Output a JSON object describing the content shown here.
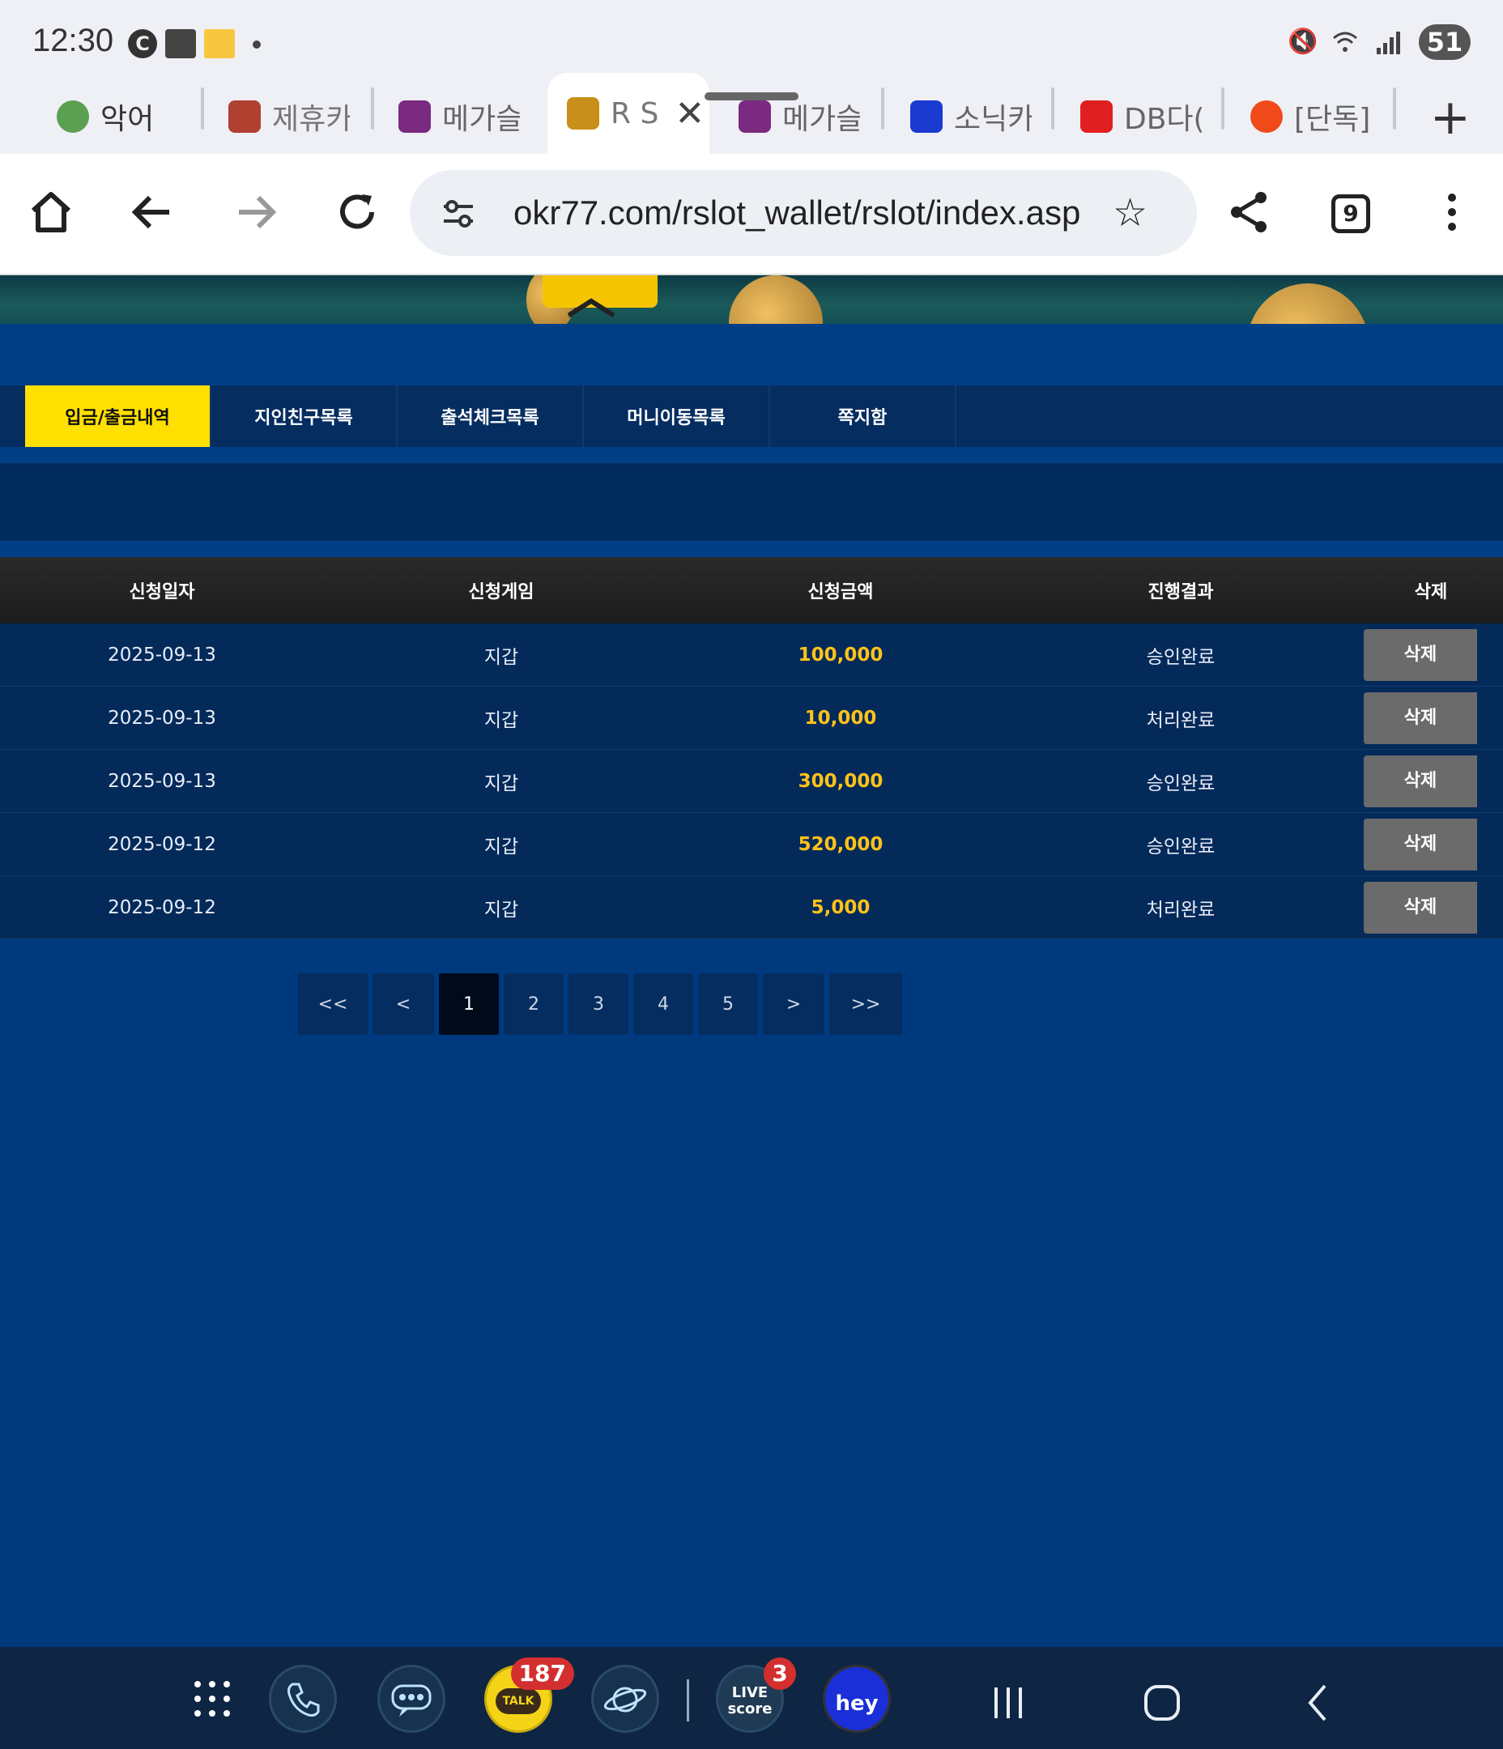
{
  "status_bar": {
    "time": "12:30",
    "left_icons": [
      "c-icon",
      "briefcase-icon",
      "kyochon-icon",
      "dot-icon"
    ],
    "right_icons": [
      "mute-icon",
      "wifi-icon",
      "signal-icon"
    ],
    "battery": "51"
  },
  "browser_tabs": [
    {
      "title": "악어",
      "icon": "crocodile-icon",
      "color": "#5aa050"
    },
    {
      "title": "제휴카",
      "icon": "slot-machine-icon",
      "color": "#b04030"
    },
    {
      "title": "메가슬",
      "icon": "m-logo-icon",
      "color": "#7a2a80"
    },
    {
      "title": "R S",
      "icon": "r-logo-icon",
      "color": "#c8901a",
      "active": true
    },
    {
      "title": "메가슬",
      "icon": "m-logo-icon",
      "color": "#7a2a80"
    },
    {
      "title": "소닉카",
      "icon": "s-logo-icon",
      "color": "#1a3ad0"
    },
    {
      "title": "DB다(",
      "icon": "n-logo-icon",
      "color": "#e02020"
    },
    {
      "title": "[단독]",
      "icon": "i-logo-icon",
      "color": "#f04a1a"
    }
  ],
  "url_bar": {
    "url": "okr77.com/rslot_wallet/rslot/index.asp",
    "tab_count": "9"
  },
  "menu_tabs": [
    {
      "label": "입금/출금내역",
      "active": true
    },
    {
      "label": "지인친구목록"
    },
    {
      "label": "출석체크목록"
    },
    {
      "label": "머니이동목록"
    },
    {
      "label": "쪽지함"
    }
  ],
  "table": {
    "headers": [
      "신청일자",
      "신청게임",
      "신청금액",
      "진행결과",
      "삭제"
    ],
    "rows": [
      {
        "date": "2025-09-13",
        "game": "지갑",
        "amount": "100,000",
        "result": "승인완료",
        "action": "삭제"
      },
      {
        "date": "2025-09-13",
        "game": "지갑",
        "amount": "10,000",
        "result": "처리완료",
        "action": "삭제"
      },
      {
        "date": "2025-09-13",
        "game": "지갑",
        "amount": "300,000",
        "result": "승인완료",
        "action": "삭제"
      },
      {
        "date": "2025-09-12",
        "game": "지갑",
        "amount": "520,000",
        "result": "승인완료",
        "action": "삭제"
      },
      {
        "date": "2025-09-12",
        "game": "지갑",
        "amount": "5,000",
        "result": "처리완료",
        "action": "삭제"
      }
    ]
  },
  "pagination": {
    "first": "<<",
    "prev": "<",
    "pages": [
      "1",
      "2",
      "3",
      "4",
      "5"
    ],
    "current": "1",
    "next": ">",
    "last": ">>"
  },
  "dock": {
    "apps": [
      {
        "name": "phone-icon"
      },
      {
        "name": "messages-icon"
      },
      {
        "name": "kakaotalk-icon",
        "badge": "187",
        "label": "TALK"
      },
      {
        "name": "internet-icon"
      },
      {
        "name": "livescore-icon",
        "badge": "3",
        "label": "LIVE score"
      },
      {
        "name": "hey-icon",
        "label": "hey"
      }
    ]
  }
}
